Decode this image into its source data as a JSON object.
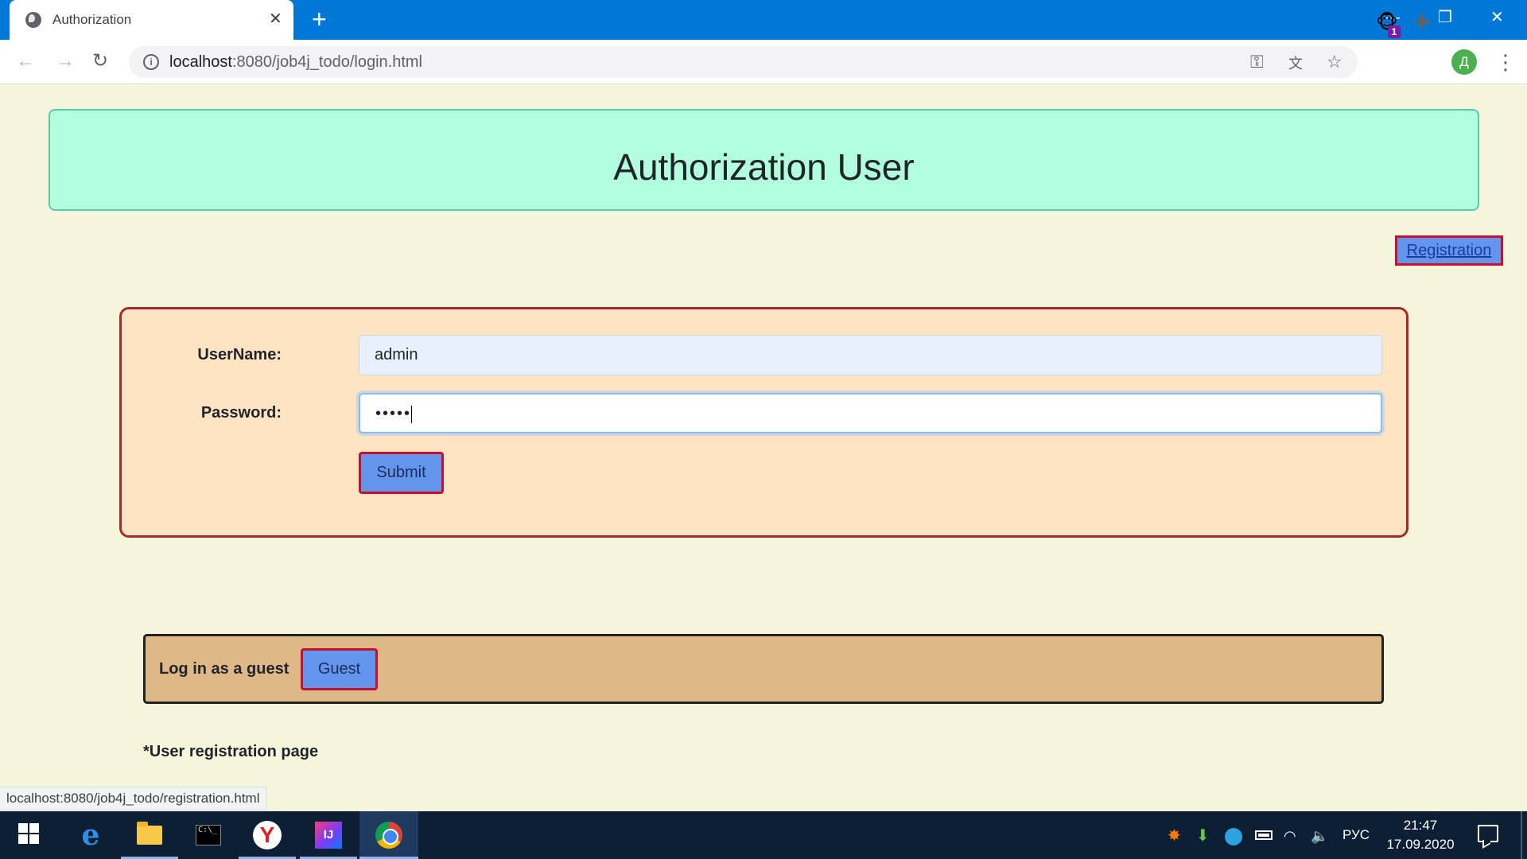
{
  "browser": {
    "tab_title": "Authorization",
    "new_tab_symbol": "+",
    "tab_close_symbol": "✕",
    "window_controls": {
      "minimize": "—",
      "maximize": "❐",
      "close": "✕"
    },
    "url_host": "localhost",
    "url_rest": ":8080/job4j_todo/login.html",
    "extension_badge": "1",
    "profile_initial": "Д",
    "menu_symbol": "⋮"
  },
  "page": {
    "header_title": "Authorization User",
    "registration_link": "Registration",
    "login_form": {
      "username_label": "UserName:",
      "username_value": "admin",
      "password_label": "Password:",
      "password_masked": "•••••",
      "submit_label": "Submit"
    },
    "guest": {
      "label": "Log in as a guest",
      "button_label": "Guest"
    },
    "note": "*User registration page",
    "status_url": "localhost:8080/job4j_todo/registration.html"
  },
  "taskbar": {
    "apps": [
      "start",
      "edge",
      "file-explorer",
      "command-prompt",
      "yandex-browser",
      "intellij-idea",
      "chrome"
    ],
    "edge_glyph": "e",
    "cmd_glyph": "C:\\_",
    "yandex_glyph": "Y",
    "idea_glyph": "IJ",
    "language": "РУС",
    "time": "21:47",
    "date": "17.09.2020"
  },
  "colors": {
    "titlebar": "#0078d7",
    "page_background": "#f5f5dc",
    "header_box": "#b2ffe0",
    "login_box": "#ffe4c4",
    "guest_box": "#deb887",
    "button": "#6495ed",
    "button_border": "#c8102e"
  }
}
